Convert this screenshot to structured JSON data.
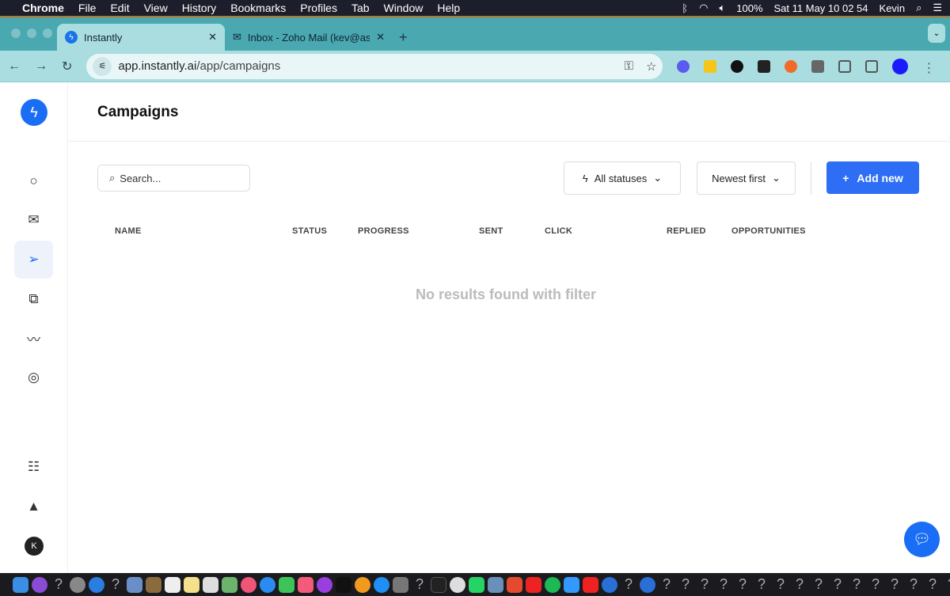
{
  "menubar": {
    "app": "Chrome",
    "items": [
      "File",
      "Edit",
      "View",
      "History",
      "Bookmarks",
      "Profiles",
      "Tab",
      "Window",
      "Help"
    ],
    "battery": "100%",
    "datetime": "Sat 11 May  10 02 54",
    "user": "Kevin"
  },
  "tabs": [
    {
      "title": "Instantly",
      "active": true
    },
    {
      "title": "Inbox - Zoho Mail (kev@askn",
      "active": false
    }
  ],
  "address": {
    "host": "app.instantly.ai",
    "path": "/app/campaigns"
  },
  "page": {
    "title": "Campaigns",
    "search_placeholder": "Search...",
    "status_filter": "All statuses",
    "sort": "Newest first",
    "add_label": "Add new",
    "empty_message": "No results found with filter"
  },
  "columns": [
    "NAME",
    "STATUS",
    "PROGRESS",
    "SENT",
    "CLICK",
    "REPLIED",
    "OPPORTUNITIES"
  ],
  "sidebar": {
    "icons": [
      "search-icon",
      "mail-icon",
      "send-icon",
      "copy-icon",
      "analytics-icon",
      "account-icon",
      "feedback-icon",
      "rocket-icon"
    ],
    "active": "send-icon",
    "avatar": "K"
  },
  "colors": {
    "accent": "#2e6ef4",
    "tabbar": "#4aa8b0",
    "toolbar": "#a9dde0"
  }
}
